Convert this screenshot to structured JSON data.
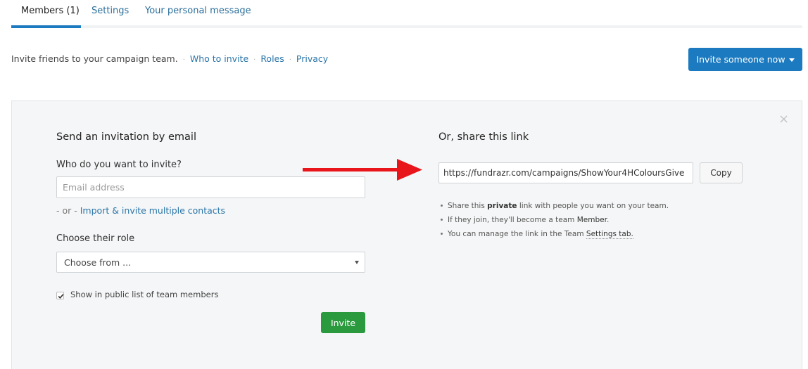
{
  "tabs": [
    {
      "label": "Members (1)",
      "active": true
    },
    {
      "label": "Settings",
      "active": false
    },
    {
      "label": "Your personal message",
      "active": false
    }
  ],
  "intro": {
    "text": "Invite friends to your campaign team.",
    "links": [
      "Who to invite",
      "Roles",
      "Privacy"
    ],
    "separator": "·"
  },
  "invite_now_label": "Invite someone now",
  "close_glyph": "×",
  "email_section": {
    "title": "Send an invitation by email",
    "who_label": "Who do you want to invite?",
    "email_placeholder": "Email address",
    "or_text": "- or -",
    "import_link": "Import & invite multiple contacts",
    "role_label": "Choose their role",
    "role_selected": "Choose from ...",
    "show_public_label": "Show in public list of team members",
    "show_public_checked": true,
    "invite_label": "Invite"
  },
  "share_section": {
    "title": "Or, share this link",
    "link_value": "https://fundrazr.com/campaigns/ShowYour4HColoursGive",
    "copy_label": "Copy",
    "bullet1_pre": "Share this",
    "bullet1_bold": "private",
    "bullet1_post": "link with people you want on your team.",
    "bullet2_pre": "If they join, they'll become a team",
    "bullet2_term": "Member",
    "bullet2_post": ".",
    "bullet3_pre": "You can manage the link in the Team",
    "bullet3_link": "Settings tab."
  },
  "colors": {
    "primary": "#1b7ac0",
    "success": "#2b9a3e",
    "arrow": "#e8161b"
  }
}
